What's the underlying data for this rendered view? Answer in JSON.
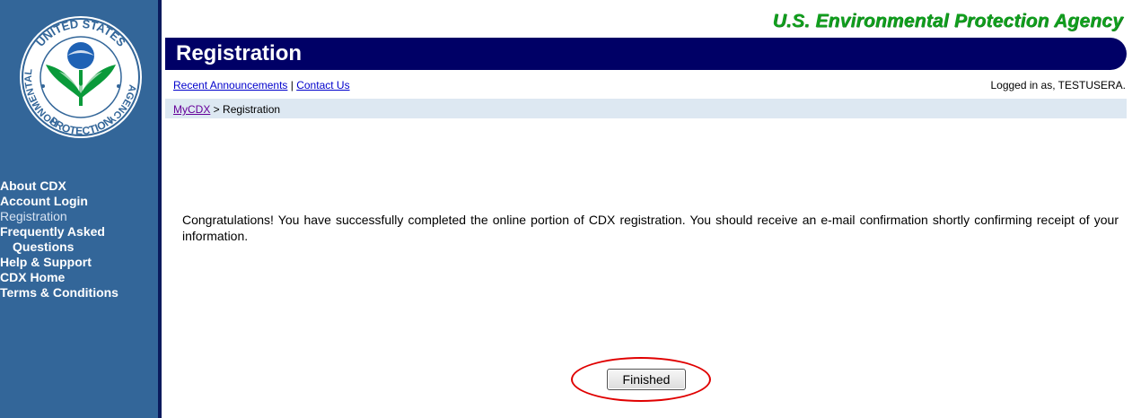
{
  "agency_title": "U.S. Environmental Protection Agency",
  "seal": {
    "top_text": "UNITED STATES",
    "left_text": "ENVIRONMENTAL",
    "right_text": "AGENCY",
    "bottom_text": "PROTECTION",
    "ring_color": "#336699",
    "flower_color": "#0a9a3a",
    "sun_color": "#1f62b5"
  },
  "sidebar": {
    "bg_color": "#336699",
    "items": [
      {
        "label": "About CDX"
      },
      {
        "label": "Account Login"
      },
      {
        "label": "Registration"
      },
      {
        "label": "Frequently Asked"
      },
      {
        "label": "Questions"
      },
      {
        "label": "Help & Support"
      },
      {
        "label": "CDX Home"
      },
      {
        "label": "Terms & Conditions"
      }
    ]
  },
  "banner": {
    "title": "Registration",
    "color": "#000066"
  },
  "links": {
    "announcements": "Recent Announcements",
    "separator": " | ",
    "contact": "Contact Us",
    "logged_in": "Logged in as, TESTUSERA."
  },
  "breadcrumb": {
    "home": "MyCDX",
    "separator": " > ",
    "current": "Registration"
  },
  "message": "Congratulations! You have successfully completed the online portion of CDX registration. You should receive an e-mail confirmation shortly confirming receipt of your information.",
  "finished_button": {
    "label": "Finished",
    "highlight_color": "#e00000"
  }
}
